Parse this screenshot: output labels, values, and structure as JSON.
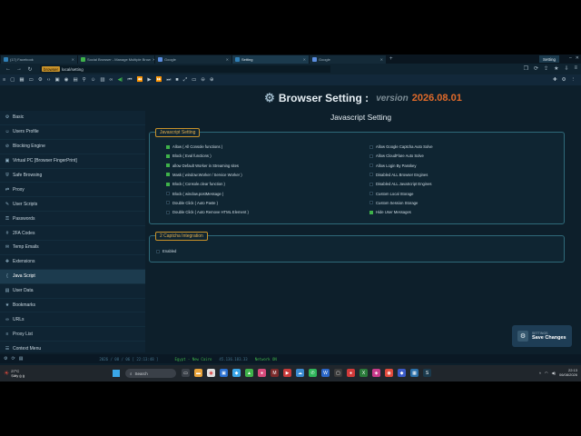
{
  "tabs": [
    {
      "label": "(17) Facebook",
      "color": "#2f7fb6"
    },
    {
      "label": "Social Browser - Manage Multiple Brow",
      "color": "#3fb24a"
    },
    {
      "label": "Google",
      "color": "#5b8de0"
    },
    {
      "label": "Setting",
      "color": "#2f7fb6"
    },
    {
      "label": "Google",
      "color": "#5b8de0"
    }
  ],
  "window_title": "Setting",
  "address": {
    "badge": "browser",
    "url": "local/setting"
  },
  "header": {
    "title": "Browser Setting :",
    "version_label": "version",
    "version": "2026.08.01"
  },
  "sidebar": {
    "items": [
      {
        "label": "Basic",
        "icon": "gear-icon",
        "glyph": "⚙"
      },
      {
        "label": "Users Profile",
        "icon": "user-icon",
        "glyph": "☺"
      },
      {
        "label": "Blocking Engine",
        "icon": "block-icon",
        "glyph": "⊘"
      },
      {
        "label": "Virtual PC [Browser FingerPrint]",
        "icon": "fingerprint-icon",
        "glyph": "▣"
      },
      {
        "label": "Safe Browsing",
        "icon": "shield-icon",
        "glyph": "⛨"
      },
      {
        "label": "Proxy",
        "icon": "proxy-icon",
        "glyph": "⇄"
      },
      {
        "label": "User Scripts",
        "icon": "script-icon",
        "glyph": "✎"
      },
      {
        "label": "Passwords",
        "icon": "key-icon",
        "glyph": "⚿"
      },
      {
        "label": "2FA Codes",
        "icon": "code-icon",
        "glyph": "#"
      },
      {
        "label": "Temp Emails",
        "icon": "mail-icon",
        "glyph": "✉"
      },
      {
        "label": "Extensions",
        "icon": "puzzle-icon",
        "glyph": "✚"
      },
      {
        "label": "Java Script",
        "icon": "js-icon",
        "glyph": "{"
      },
      {
        "label": "User Data",
        "icon": "data-icon",
        "glyph": "▤"
      },
      {
        "label": "Bookmarks",
        "icon": "bookmark-icon",
        "glyph": "★"
      },
      {
        "label": "URLs",
        "icon": "link-icon",
        "glyph": "∞"
      },
      {
        "label": "Proxy List",
        "icon": "list-icon",
        "glyph": "≡"
      },
      {
        "label": "Context Menu",
        "icon": "menu-icon",
        "glyph": "☰"
      }
    ],
    "active_index": 11
  },
  "main": {
    "section_title": "Javascript Setting",
    "js_panel": {
      "legend": "Javascript Setting",
      "left_options": [
        {
          "label": "Allow ( All Console functions )",
          "checked": true
        },
        {
          "label": "Block ( Eval functions )",
          "checked": true
        },
        {
          "label": "allow Default Worker in Streaming sites",
          "checked": true
        },
        {
          "label": "Mask ( window.Worker / Service Worker )",
          "checked": true
        },
        {
          "label": "Block ( Console.clear function )",
          "checked": true
        },
        {
          "label": "Block ( window.postMessage )",
          "checked": false
        },
        {
          "label": "Double Click ( Auto Paste )",
          "checked": false
        },
        {
          "label": "Double Click ( Auto Remove HTML Element )",
          "checked": false
        }
      ],
      "right_options": [
        {
          "label": "Allow Google Captcha Auto Solve",
          "checked": false
        },
        {
          "label": "Allow CloudFlare Auto Solve",
          "checked": false
        },
        {
          "label": "Allow Login By Passkey",
          "checked": false
        },
        {
          "label": "Disabled ALL Browser Engines",
          "checked": false
        },
        {
          "label": "Disabled ALL JavaScript Engines",
          "checked": false
        },
        {
          "label": "Custom Local Storage",
          "checked": false
        },
        {
          "label": "Custom Session Storage",
          "checked": false
        },
        {
          "label": "Hide User Messages",
          "checked": true
        }
      ]
    },
    "captcha_panel": {
      "legend": "2 Captcha Integration",
      "option": {
        "label": "Enabled",
        "checked": false
      }
    },
    "save": {
      "small": "SETTINGS",
      "big": "Save Changes"
    }
  },
  "status": {
    "stamp": "2026 / 08 / 06 [ 22:13:48 ]",
    "location": "Egypt - New Cairo",
    "ip": "45.136.183.33",
    "network": "Network ON"
  },
  "taskbar": {
    "temp": "27°C",
    "weather_text": "Ṣāfy ǧ ǧ",
    "search": "Search",
    "time": "22:13",
    "date": "06/08/2026"
  },
  "colors": {
    "accent": "#3fb24a",
    "legend_border": "#c8922a",
    "version": "#e06a2a"
  }
}
